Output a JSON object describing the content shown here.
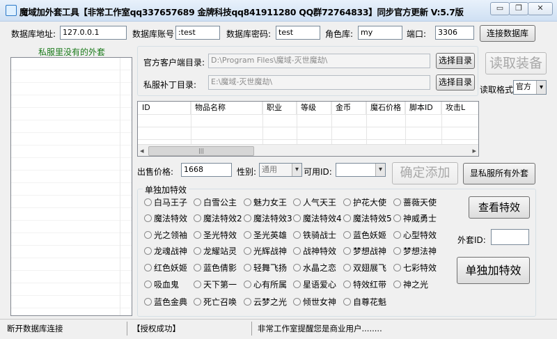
{
  "window": {
    "title": "魔域加外套工具【非常工作室qq337657689 金牌科技qq841911280 QQ群72764833】同步官方更新 V:5.7版",
    "minimize_glyph": "▭",
    "restore_glyph": "❐",
    "close_glyph": "✕"
  },
  "db": {
    "address_label": "数据库地址:",
    "address_value": "127.0.0.1",
    "account_label": "数据库账号",
    "account_value": ":test",
    "password_label": "数据库密码:",
    "password_value": "test",
    "role_label": "角色库:",
    "role_value": "my",
    "port_label": "端口:",
    "port_value": "3306",
    "connect_button": "连接数据库"
  },
  "left_panel": {
    "title": "私服里没有的外套"
  },
  "paths": {
    "official_label": "官方客户端目录:",
    "official_value": "D:\\Program Files\\魔域-灭世魔劫\\",
    "private_label": "私服补丁目录:",
    "private_value": "E:\\魔域-灭世魔劫\\",
    "select_button": "选择目录",
    "read_equipment_button": "读取装备",
    "read_format_label": "读取格式",
    "read_format_value": "官方",
    "dropdown_glyph": "▾"
  },
  "grid": {
    "columns": [
      "ID",
      "物品名称",
      "职业",
      "等级",
      "金币",
      "魔石价格",
      "脚本ID",
      "攻击L"
    ],
    "scroll_left": "◂",
    "scroll_right": "▸",
    "thumb_glyph": "|||"
  },
  "sale": {
    "price_label": "出售价格:",
    "price_value": "1668",
    "gender_label": "性别:",
    "gender_value": "通用",
    "usable_id_label": "可用ID:",
    "usable_id_value": "",
    "confirm_button": "确定添加",
    "show_all_button": "显私服所有外套"
  },
  "effects": {
    "group_title": "单独加特效",
    "items": [
      "白马王子",
      "白雪公主",
      "魅力女王",
      "人气天王",
      "护花大使",
      "蔷薇天使",
      "魔法特效",
      "魔法特效2",
      "魔法特效3",
      "魔法特效4",
      "魔法特效5",
      "神威勇士",
      "光之领袖",
      "圣光特效",
      "圣光英雄",
      "铁骑战士",
      "蓝色妖姬",
      "心型特效",
      "龙魂战神",
      "龙耀站灵",
      "光辉战神",
      "战神特效",
      "梦想战神",
      "梦想法神",
      "红色妖姬",
      "蓝色倩影",
      "轻舞飞扬",
      "水晶之恋",
      "双翅展飞",
      "七彩特效",
      "吸血鬼",
      "天下第一",
      "心有所属",
      "星语爱心",
      "特效红带",
      "神之光",
      "蓝色金典",
      "死亡召唤",
      "云梦之光",
      "倾世女神",
      "自尊花魁"
    ],
    "view_button": "查看特效",
    "coat_id_label": "外套ID:",
    "coat_id_value": "",
    "add_effect_button": "单独加特效"
  },
  "status": {
    "left": "断开数据库连接",
    "middle": "【授权成功】",
    "right": "非常工作室提醒您是商业用户........"
  }
}
